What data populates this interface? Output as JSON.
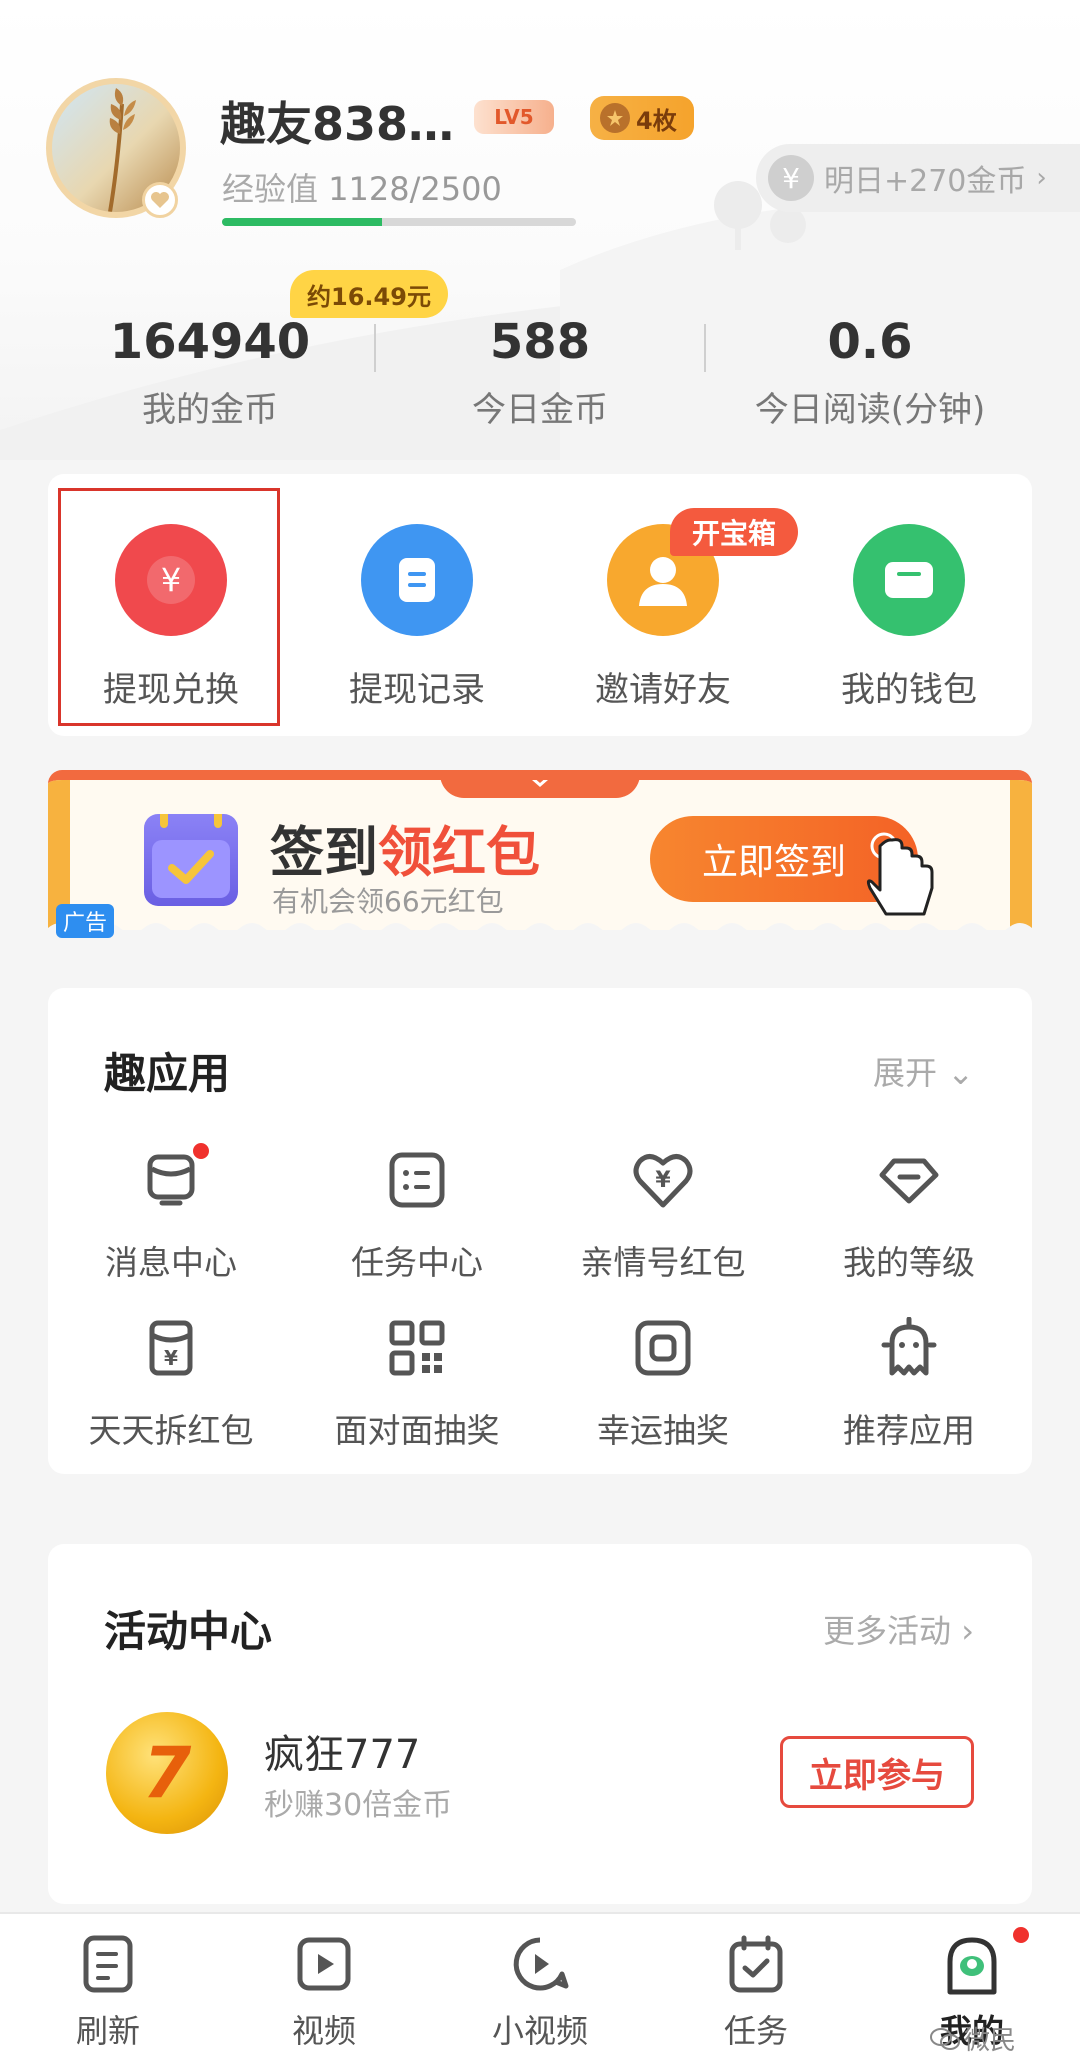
{
  "header": {
    "username": "趣友838…",
    "level_badge": "LV5",
    "medal_badge": "4枚",
    "exp_label": "经验值",
    "exp_value": "1128/2500",
    "exp_progress": 0.451,
    "tomorrow_reward": "明日+270金币",
    "tomorrow_icon": "¥",
    "approx_value": "约16.49元"
  },
  "stats": [
    {
      "value": "164940",
      "label": "我的金币"
    },
    {
      "value": "588",
      "label": "今日金币"
    },
    {
      "value": "0.6",
      "label": "今日阅读(分钟)"
    }
  ],
  "quick_actions": [
    {
      "label": "提现兑换",
      "icon": "yen-icon",
      "color": "#f0494d"
    },
    {
      "label": "提现记录",
      "icon": "record-icon",
      "color": "#3f96f2"
    },
    {
      "label": "邀请好友",
      "icon": "person-icon",
      "color": "#f8a82e"
    },
    {
      "label": "我的钱包",
      "icon": "wallet-icon",
      "color": "#35c16f"
    }
  ],
  "treasure_tag": "开宝箱",
  "banner": {
    "title_black": "签到",
    "title_red": "领红包",
    "subtitle": "有机会领66元红包",
    "button": "立即签到",
    "ad_tag": "广告"
  },
  "apps_section": {
    "title": "趣应用",
    "expand": "展开",
    "items": [
      {
        "label": "消息中心",
        "icon": "bell-icon"
      },
      {
        "label": "任务中心",
        "icon": "task-list-icon"
      },
      {
        "label": "亲情号红包",
        "icon": "heart-yen-icon"
      },
      {
        "label": "我的等级",
        "icon": "diamond-icon"
      },
      {
        "label": "天天拆红包",
        "icon": "red-envelope-icon"
      },
      {
        "label": "面对面抽奖",
        "icon": "qr-code-icon"
      },
      {
        "label": "幸运抽奖",
        "icon": "lucky-draw-icon"
      },
      {
        "label": "推荐应用",
        "icon": "robot-icon"
      }
    ]
  },
  "activity_section": {
    "title": "活动中心",
    "more": "更多活动",
    "item": {
      "title": "疯狂777",
      "subtitle": "秒赚30倍金币",
      "badge": "7",
      "button": "立即参与"
    }
  },
  "bottom_nav": [
    {
      "label": "刷新",
      "icon": "news-icon"
    },
    {
      "label": "视频",
      "icon": "video-icon"
    },
    {
      "label": "小视频",
      "icon": "short-video-icon"
    },
    {
      "label": "任务",
      "icon": "task-calendar-icon"
    },
    {
      "label": "我的",
      "icon": "profile-icon"
    }
  ],
  "watermark": "微民",
  "colors": {
    "accent_red": "#f0503a",
    "green": "#2dbb63",
    "gold": "#ffd445"
  }
}
